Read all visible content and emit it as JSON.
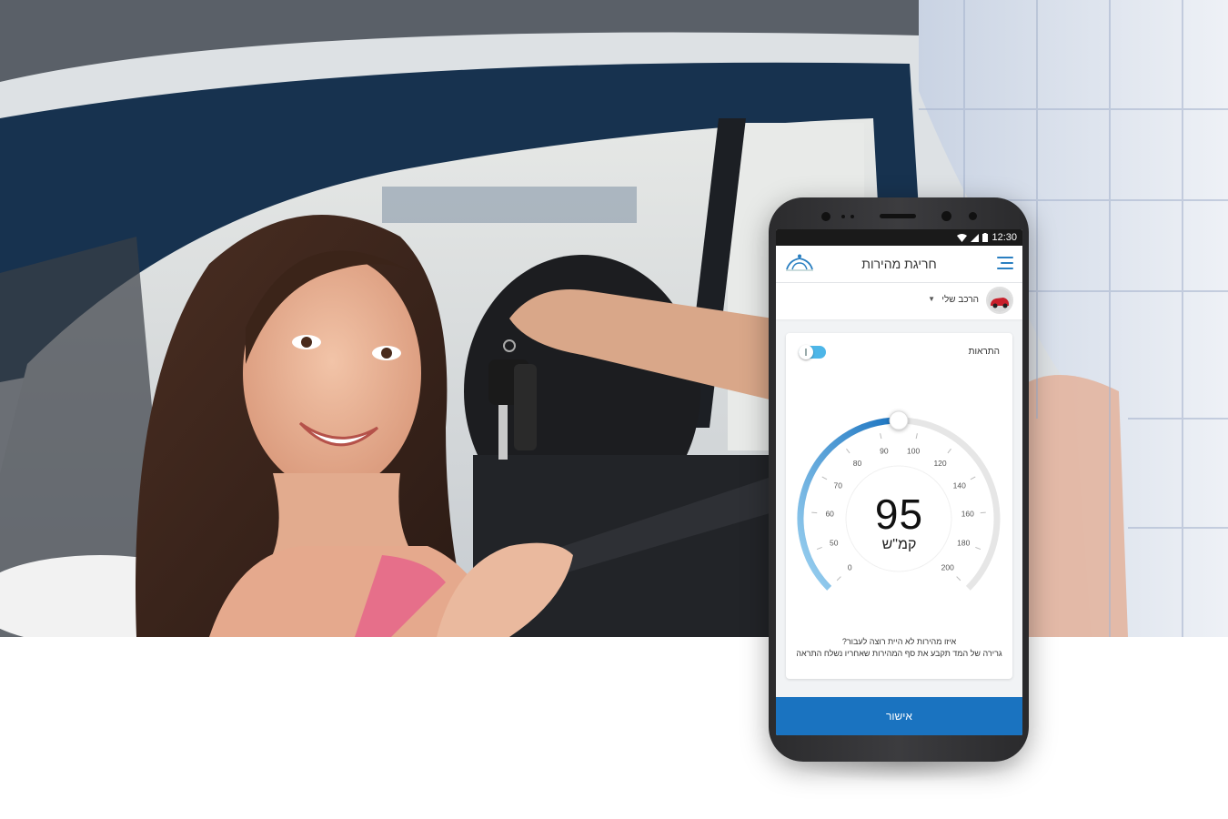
{
  "status_bar": {
    "time": "12:30"
  },
  "header": {
    "title": "חריגת מהירות",
    "logo_icon": "car-roof-logo-icon",
    "menu_icon": "hamburger-menu-icon"
  },
  "vehicle": {
    "label": "הרכב שלי",
    "dropdown_icon": "caret-down-icon"
  },
  "alerts": {
    "label": "התראות",
    "enabled": true
  },
  "gauge": {
    "value": 95,
    "unit": "קמ\"ש",
    "ticks": [
      "0",
      "50",
      "60",
      "70",
      "80",
      "90",
      "100",
      "120",
      "140",
      "160",
      "180",
      "200"
    ],
    "min": 0,
    "max": 200
  },
  "prompt": {
    "question": "איזו מהירות לא היית רוצה לעבור?",
    "hint": "גרירה של המד תקבע את סף המהירות שאחריו נשלח התראה"
  },
  "actions": {
    "confirm": "אישור"
  },
  "colors": {
    "accent": "#1a73c0",
    "gauge_active": "#4aa3df",
    "gauge_track": "#e6e6e6"
  }
}
